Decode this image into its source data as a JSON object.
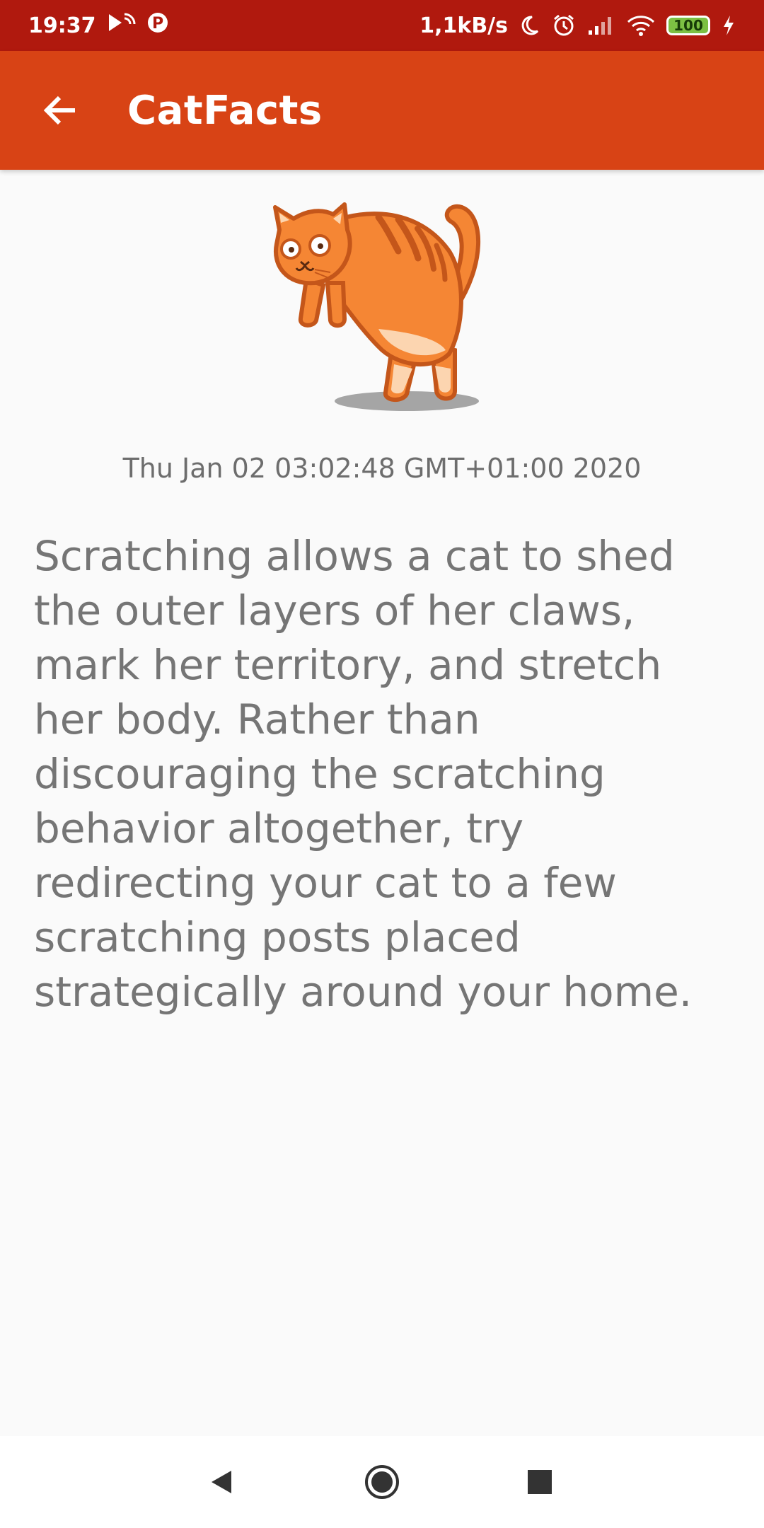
{
  "status_bar": {
    "time": "19:37",
    "net_speed": "1,1kB/s",
    "battery": "100",
    "p_badge": "P"
  },
  "app_bar": {
    "title": "CatFacts",
    "back_icon": "arrow-back-icon"
  },
  "content": {
    "illustration": "cat-illustration",
    "timestamp": "Thu Jan 02 03:02:48 GMT+01:00 2020",
    "fact": "Scratching allows a cat to shed the outer layers of her claws, mark her territory, and stretch her body. Rather than discouraging the scratching behavior altogether, try redirecting your cat to a few scratching posts placed strategically around your home."
  },
  "nav_bar": {
    "back": "nav-back-icon",
    "home": "nav-home-icon",
    "recents": "nav-recents-icon"
  },
  "colors": {
    "status_bar": "#b0190e",
    "app_bar": "#d84315",
    "background": "#fafafa",
    "text": "#757575",
    "cat_orange": "#f58634"
  }
}
